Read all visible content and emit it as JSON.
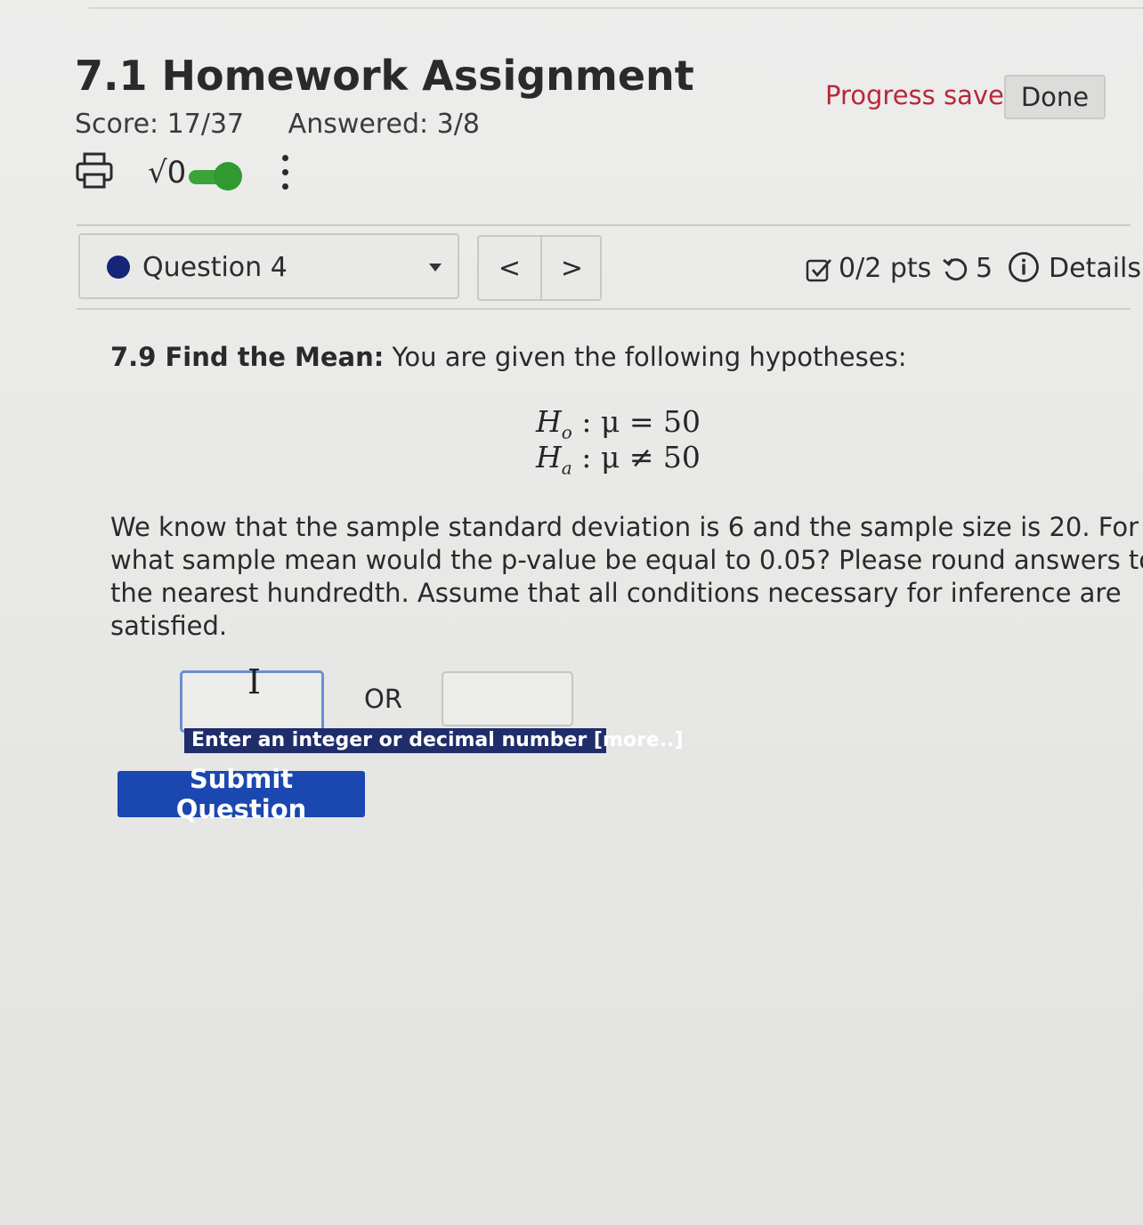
{
  "assignment": {
    "title": "7.1 Homework Assignment",
    "score": "Score: 17/37",
    "answered": "Answered: 3/8"
  },
  "toolbar": {
    "icons": [
      "printer-icon",
      "sqrt-icon",
      "toggle-switch",
      "kebab-menu-icon"
    ],
    "sqrt_glyph": "√0",
    "toggle_on": true
  },
  "header": {
    "progress_status": "Progress saved",
    "done_label": "Done"
  },
  "question_nav": {
    "selected": "Question 4",
    "prev_glyph": "<",
    "next_glyph": ">"
  },
  "meta": {
    "points": "0/2 pts",
    "retries": "5",
    "details_label": "Details"
  },
  "question": {
    "number_title": "7.9 Find the Mean:",
    "intro": " You are given the following hypotheses:",
    "hyp_null": {
      "H": "H",
      "sub": "o",
      "rest": " : μ = 50"
    },
    "hyp_alt": {
      "H": "H",
      "sub": "a",
      "rest": " : μ ≠ 50"
    },
    "body_lines": [
      "We know that the sample standard deviation is 6 and the sample size is 20. For",
      "what sample mean would the p-value be equal to 0.05? Please round answers to",
      "the nearest hundredth. Assume that all conditions necessary for inference are",
      "satisfied."
    ]
  },
  "answer": {
    "input1_value": "",
    "or_label": "OR",
    "input2_value": "",
    "hint": "Enter an integer or decimal number [more..]",
    "submit_label": "Submit Question"
  },
  "colors": {
    "progress_saved": "#b8283a",
    "submit_button": "#1b47b0",
    "hint_bg": "#1f2d6a",
    "question_dot": "#14257a",
    "toggle": "#3aa33a"
  }
}
